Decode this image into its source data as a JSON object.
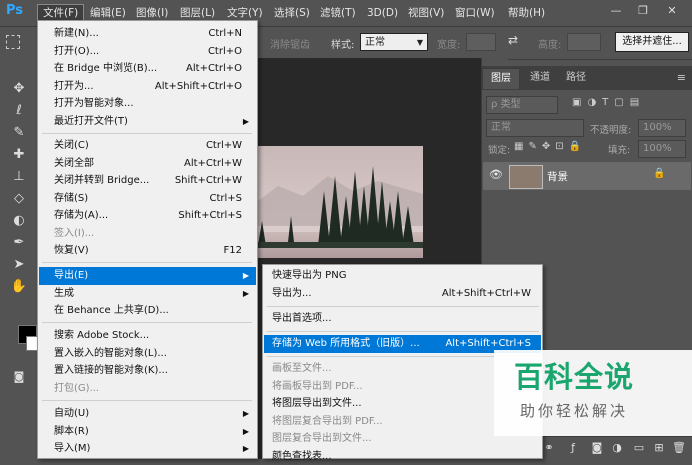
{
  "app": {
    "logo": "Ps",
    "menu": [
      "文件(F)",
      "编辑(E)",
      "图像(I)",
      "图层(L)",
      "文字(Y)",
      "选择(S)",
      "滤镜(T)",
      "3D(D)",
      "视图(V)",
      "窗口(W)",
      "帮助(H)"
    ],
    "window_controls": [
      "minimize-icon",
      "restore-icon",
      "close-icon"
    ]
  },
  "options_bar": {
    "feather_label": "消除锯齿",
    "style_label": "样式:",
    "style_value": "正常",
    "width_label": "宽度:",
    "height_label": "高度:",
    "refine_button": "选择并遮住..."
  },
  "file_menu": {
    "items": [
      {
        "label": "新建(N)...",
        "shortcut": "Ctrl+N"
      },
      {
        "label": "打开(O)...",
        "shortcut": "Ctrl+O"
      },
      {
        "label": "在 Bridge 中浏览(B)...",
        "shortcut": "Alt+Ctrl+O"
      },
      {
        "label": "打开为...",
        "shortcut": "Alt+Shift+Ctrl+O"
      },
      {
        "label": "打开为智能对象...",
        "shortcut": ""
      },
      {
        "label": "最近打开文件(T)",
        "shortcut": ""
      },
      {
        "label": "关闭(C)",
        "shortcut": "Ctrl+W"
      },
      {
        "label": "关闭全部",
        "shortcut": "Alt+Ctrl+W"
      },
      {
        "label": "关闭并转到 Bridge...",
        "shortcut": "Shift+Ctrl+W"
      },
      {
        "label": "存储(S)",
        "shortcut": "Ctrl+S"
      },
      {
        "label": "存储为(A)...",
        "shortcut": "Shift+Ctrl+S"
      },
      {
        "label": "签入(I)...",
        "shortcut": ""
      },
      {
        "label": "恢复(V)",
        "shortcut": "F12"
      },
      {
        "label": "导出(E)",
        "shortcut": ""
      },
      {
        "label": "生成",
        "shortcut": ""
      },
      {
        "label": "在 Behance 上共享(D)...",
        "shortcut": ""
      },
      {
        "label": "搜索 Adobe Stock...",
        "shortcut": ""
      },
      {
        "label": "置入嵌入的智能对象(L)...",
        "shortcut": ""
      },
      {
        "label": "置入链接的智能对象(K)...",
        "shortcut": ""
      },
      {
        "label": "打包(G)...",
        "shortcut": ""
      },
      {
        "label": "自动(U)",
        "shortcut": ""
      },
      {
        "label": "脚本(R)",
        "shortcut": ""
      },
      {
        "label": "导入(M)",
        "shortcut": ""
      }
    ]
  },
  "export_menu": {
    "items": [
      {
        "label": "快速导出为 PNG",
        "shortcut": ""
      },
      {
        "label": "导出为...",
        "shortcut": "Alt+Shift+Ctrl+W"
      },
      {
        "label": "导出首选项...",
        "shortcut": ""
      },
      {
        "label": "存储为 Web 所用格式（旧版）...",
        "shortcut": "Alt+Shift+Ctrl+S"
      },
      {
        "label": "画板至文件...",
        "shortcut": ""
      },
      {
        "label": "将画板导出到 PDF...",
        "shortcut": ""
      },
      {
        "label": "将图层导出到文件...",
        "shortcut": ""
      },
      {
        "label": "将图层复合导出到 PDF...",
        "shortcut": ""
      },
      {
        "label": "图层复合导出到文件...",
        "shortcut": ""
      },
      {
        "label": "颜色查找表...",
        "shortcut": ""
      }
    ]
  },
  "layers_panel": {
    "tabs": [
      "图层",
      "通道",
      "路径"
    ],
    "filter_label": "ρ 类型",
    "blend_mode": "正常",
    "opacity_label": "不透明度:",
    "opacity_value": "100%",
    "lock_label": "锁定:",
    "fill_label": "填充:",
    "fill_value": "100%",
    "layer_name": "背景"
  },
  "watermark": {
    "title": "百科全说",
    "subtitle": "助你轻松解决"
  }
}
